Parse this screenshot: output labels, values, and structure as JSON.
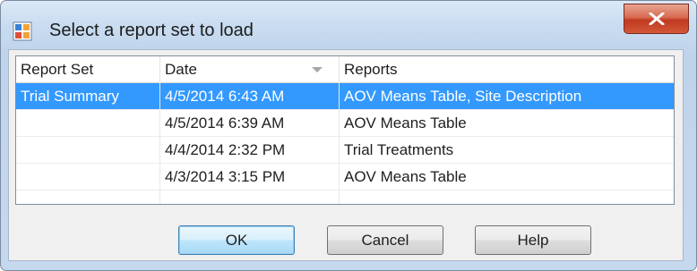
{
  "window": {
    "title": "Select a report set to load",
    "close_icon": "close-icon"
  },
  "table": {
    "columns": [
      {
        "label": "Report Set"
      },
      {
        "label": "Date",
        "sorted": "descending"
      },
      {
        "label": "Reports"
      }
    ],
    "rows": [
      {
        "report_set": "Trial Summary",
        "date": "4/5/2014 6:43 AM",
        "reports": "AOV Means Table, Site Description",
        "selected": true
      },
      {
        "report_set": "",
        "date": "4/5/2014 6:39 AM",
        "reports": "AOV Means Table",
        "selected": false
      },
      {
        "report_set": "",
        "date": "4/4/2014 2:32 PM",
        "reports": "Trial Treatments",
        "selected": false
      },
      {
        "report_set": "",
        "date": "4/3/2014 3:15 PM",
        "reports": "AOV Means Table",
        "selected": false
      }
    ]
  },
  "buttons": {
    "ok": "OK",
    "cancel": "Cancel",
    "help": "Help"
  },
  "colors": {
    "selection": "#3399ff",
    "close_button": "#c7432a"
  }
}
